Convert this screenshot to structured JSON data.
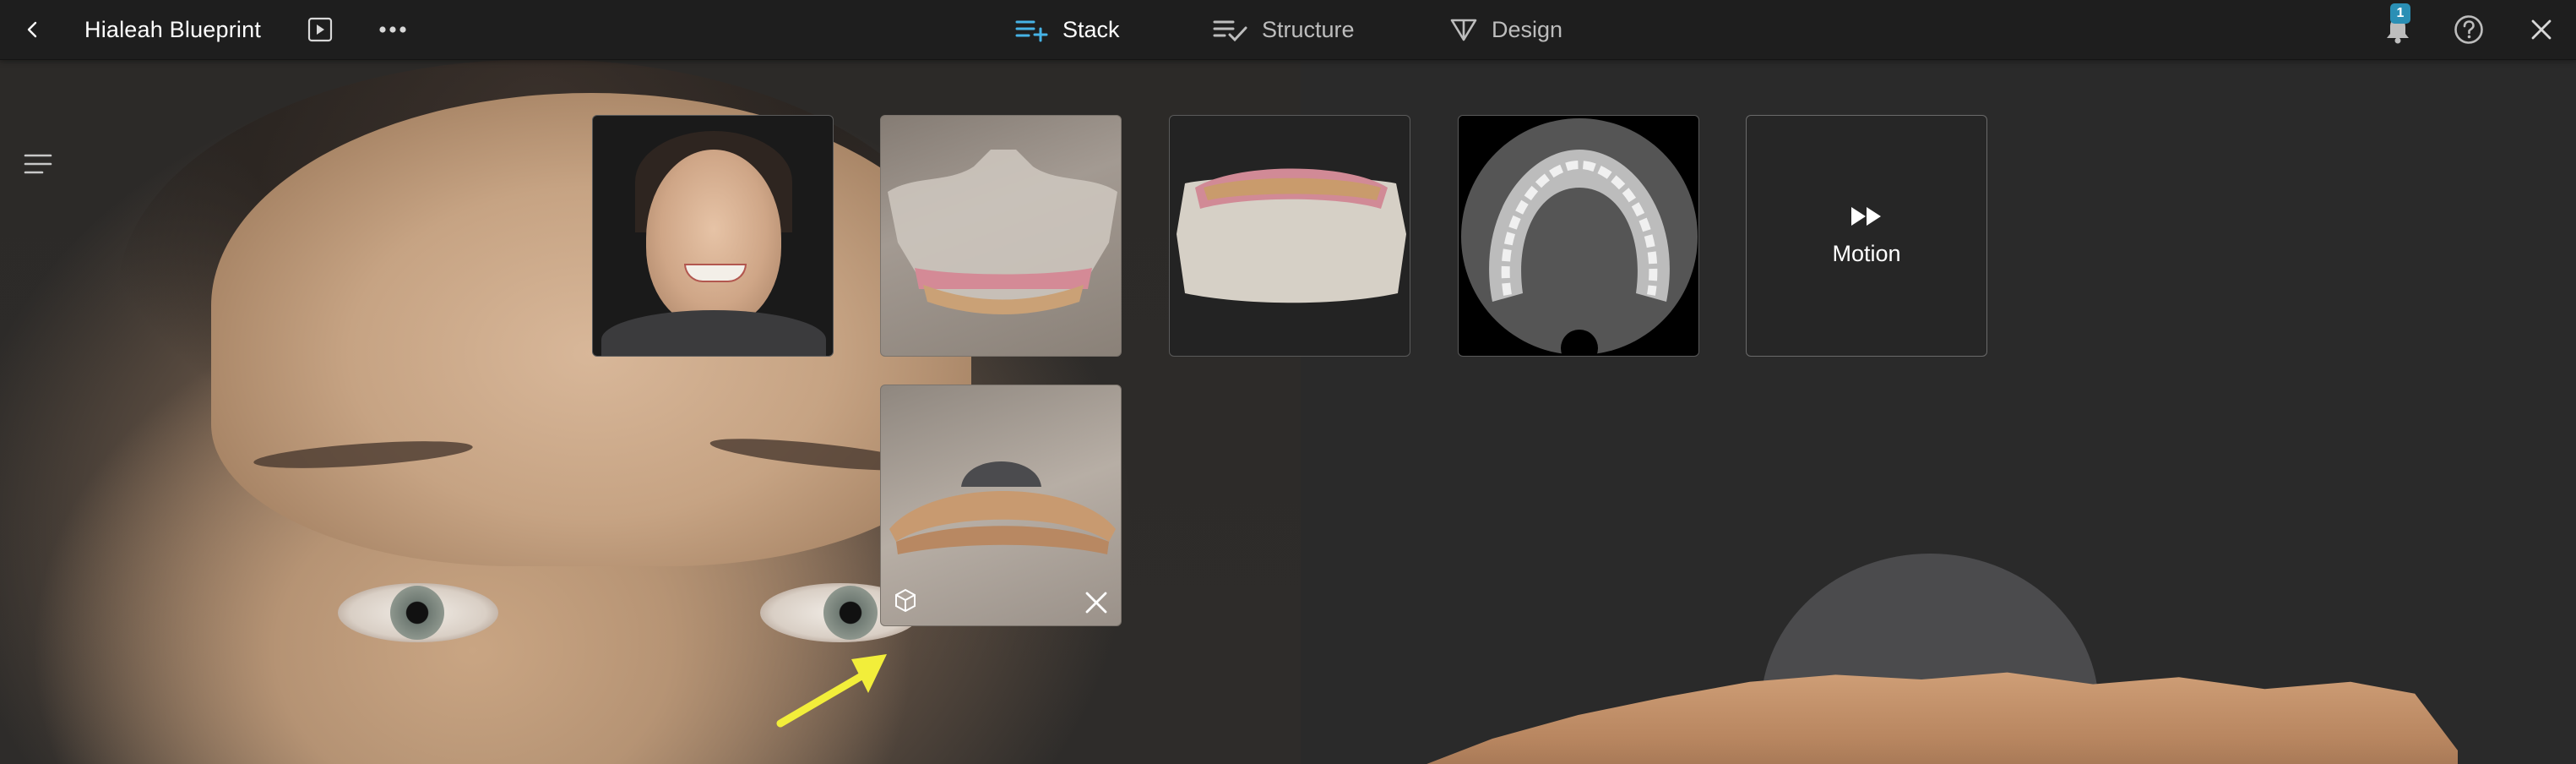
{
  "header": {
    "back_icon": "chevron-left-icon",
    "title": "Hialeah Blueprint",
    "play_icon": "play-box-icon",
    "more_icon": "more-horizontal-icon"
  },
  "nav": {
    "tabs": [
      {
        "label": "Stack",
        "icon": "stack-add-icon",
        "active": true
      },
      {
        "label": "Structure",
        "icon": "list-check-icon",
        "active": false
      },
      {
        "label": "Design",
        "icon": "triangle-down-icon",
        "active": false
      }
    ],
    "accent": "#46b3e6"
  },
  "actions": {
    "notifications_count": "1",
    "badge_color": "#2a8fb5",
    "help_icon": "help-circle-icon",
    "close_icon": "close-icon"
  },
  "stack": {
    "cards": [
      {
        "kind": "photo",
        "icon": "portrait-photo"
      },
      {
        "kind": "3d-model-upper-scan",
        "icon": "dental-model"
      },
      {
        "kind": "3d-model-arch",
        "icon": "dental-model"
      },
      {
        "kind": "ct-slice",
        "icon": "ct-scan"
      },
      {
        "kind": "motion",
        "label": "Motion",
        "icon": "fast-forward-icon"
      },
      {
        "kind": "3d-model-lower-scan",
        "icon": "dental-model"
      }
    ],
    "selected_card_icons": [
      "rotate-3d-icon",
      "close-icon"
    ]
  },
  "annotation": {
    "arrow_color": "#f2ee3a"
  },
  "sidebar": {
    "toggle_icon": "menu-lines-icon"
  }
}
